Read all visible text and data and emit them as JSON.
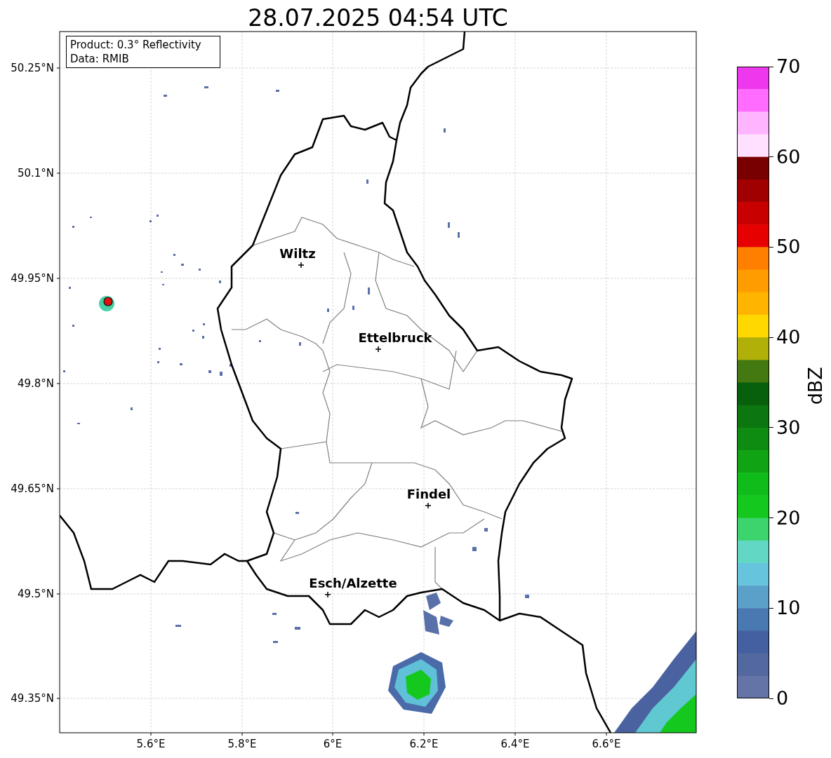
{
  "title": "28.07.2025 04:54 UTC",
  "info_box": [
    "Product: 0.3° Reflectivity",
    "Data: RMIB"
  ],
  "map": {
    "y_ticks": [
      "50.25°N",
      "50.1°N",
      "49.95°N",
      "49.8°N",
      "49.65°N",
      "49.5°N",
      "49.35°N"
    ],
    "x_ticks": [
      "5.6°E",
      "5.8°E",
      "6°E",
      "6.2°E",
      "6.4°E",
      "6.6°E"
    ],
    "cities": [
      {
        "name": "Wiltz"
      },
      {
        "name": "Ettelbruck"
      },
      {
        "name": "Findel"
      },
      {
        "name": "Esch/Alzette"
      }
    ]
  },
  "colorbar": {
    "label": "dBZ",
    "ticks": [
      "70",
      "60",
      "50",
      "40",
      "30",
      "20",
      "10",
      "0"
    ],
    "bins": [
      {
        "color": "#ee38ee"
      },
      {
        "color": "#ff6cff"
      },
      {
        "color": "#ffb4ff"
      },
      {
        "color": "#ffe0ff"
      },
      {
        "color": "#780000"
      },
      {
        "color": "#a00000"
      },
      {
        "color": "#c80000"
      },
      {
        "color": "#e60000"
      },
      {
        "color": "#ff8000"
      },
      {
        "color": "#ff9c00"
      },
      {
        "color": "#ffb400"
      },
      {
        "color": "#ffd800"
      },
      {
        "color": "#b0b008"
      },
      {
        "color": "#447810"
      },
      {
        "color": "#08600c"
      },
      {
        "color": "#0c7610"
      },
      {
        "color": "#0e8c12"
      },
      {
        "color": "#10a414"
      },
      {
        "color": "#10bc1a"
      },
      {
        "color": "#14c81e"
      },
      {
        "color": "#3cd46c"
      },
      {
        "color": "#62d8c4"
      },
      {
        "color": "#66c4dc"
      },
      {
        "color": "#5aa0c8"
      },
      {
        "color": "#4a78b0"
      },
      {
        "color": "#4460a0"
      },
      {
        "color": "#53689e"
      },
      {
        "color": "#6474a6"
      }
    ]
  }
}
